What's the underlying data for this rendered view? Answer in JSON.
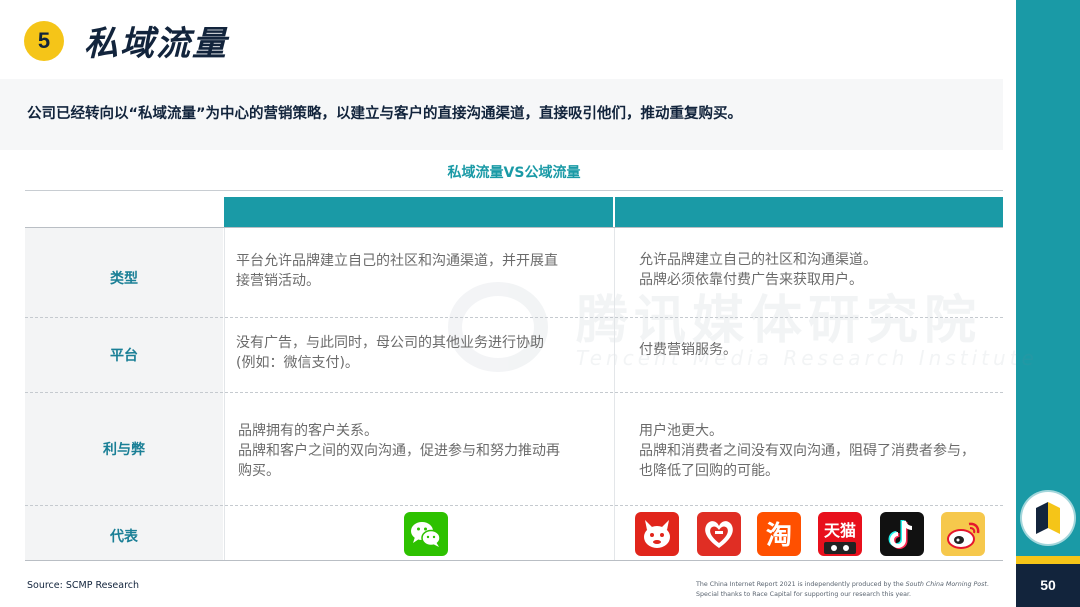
{
  "header": {
    "number": "5",
    "title": "私域流量"
  },
  "intro": "公司已经转向以“私域流量”为中心的营销策略，以建立与客户的直接沟通渠道，直接吸引他们，推动重复购买。",
  "table": {
    "title": "私域流量VS公域流量",
    "headers": [
      "",
      "",
      ""
    ],
    "rows": [
      {
        "label": "类型",
        "private": [
          "平台允许品牌建立自己的社区和沟通渠道，并开展直",
          "接营销活动。"
        ],
        "public": [
          "允许品牌建立自己的社区和沟通渠道。",
          "品牌必须依靠付费广告来获取用户。"
        ]
      },
      {
        "label": "平台",
        "private": [
          "没有广告，与此同时，母公司的其他业务进行协助",
          "(例如：微信支付)。"
        ],
        "public": [
          "付费营销服务。"
        ]
      },
      {
        "label": "利与弊",
        "private": [
          "品牌拥有的客户关系。",
          "品牌和客户之间的双向沟通，促进参与和努力推动再",
          "购买。"
        ],
        "public": [
          "用户池更大。",
          "品牌和消费者之间没有双向沟通，阻碍了消费者参与，",
          "也降低了回购的可能。"
        ]
      },
      {
        "label": "代表",
        "private_icons": [
          "wechat-icon"
        ],
        "public_icons": [
          "jd-icon",
          "pinduoduo-icon",
          "taobao-icon",
          "tmall-icon",
          "douyin-icon",
          "weibo-icon"
        ]
      }
    ],
    "tmall_text": "天猫"
  },
  "watermark": {
    "cn": "腾讯媒体研究院",
    "en": "Tencent Media Research Institute"
  },
  "footer": {
    "source": "Source: SCMP Research",
    "note_line1_prefix": "The China Internet Report 2021 is independently produced by the ",
    "note_line1_em": "South China Morning Post",
    "note_line1_suffix": ".",
    "note_line2": "Special thanks to Race Capital for supporting our research this year.",
    "page_number": "50"
  },
  "colors": {
    "teal": "#1a9aa6",
    "navy": "#12243c",
    "gold": "#f5c518"
  }
}
